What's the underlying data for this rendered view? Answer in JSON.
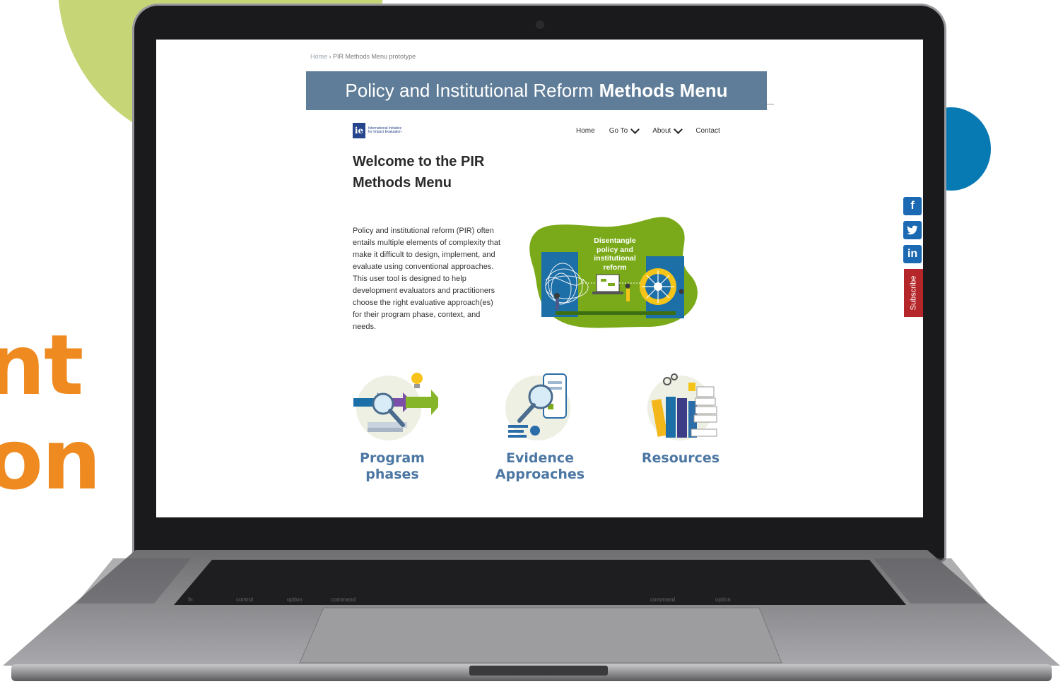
{
  "background": {
    "text_line_1": "nt",
    "text_line_2": "on",
    "accent_orange": "#ee8a1f",
    "accent_green": "#c6d676",
    "accent_blue": "#0779b3"
  },
  "breadcrumb": {
    "home": "Home",
    "separator": " › ",
    "current": "PIR Methods Menu prototype"
  },
  "banner": {
    "title_regular": "Policy and Institutional Reform",
    "title_bold": "Methods Menu",
    "color": "#5f7d98"
  },
  "logo": {
    "mark": "ie",
    "text": "International Initiative for Impact Evaluation"
  },
  "nav": {
    "home": "Home",
    "goto": "Go To",
    "about": "About",
    "contact": "Contact"
  },
  "welcome": {
    "heading": "Welcome to the PIR Methods Menu"
  },
  "intro": {
    "text": "Policy and institutional reform (PIR) often entails multiple elements of complexity that make it difficult to design, implement, and evaluate using conventional approaches. This user tool is designed to help development evaluators and practitioners choose the right evaluative approach(es) for their program phase, context, and needs."
  },
  "hero": {
    "caption": "Disentangle policy and institutional reform",
    "color": "#7aaa19"
  },
  "cards": [
    {
      "label": "Program phases"
    },
    {
      "label": "Evidence Approaches"
    },
    {
      "label": "Resources"
    }
  ],
  "social": {
    "facebook": "f",
    "twitter": "t",
    "linkedin": "in",
    "subscribe": "Subscribe"
  },
  "keyboard": {
    "fn": "fn",
    "control": "control",
    "option_left": "option",
    "command_left": "command",
    "command_right": "command",
    "option_right": "option"
  }
}
